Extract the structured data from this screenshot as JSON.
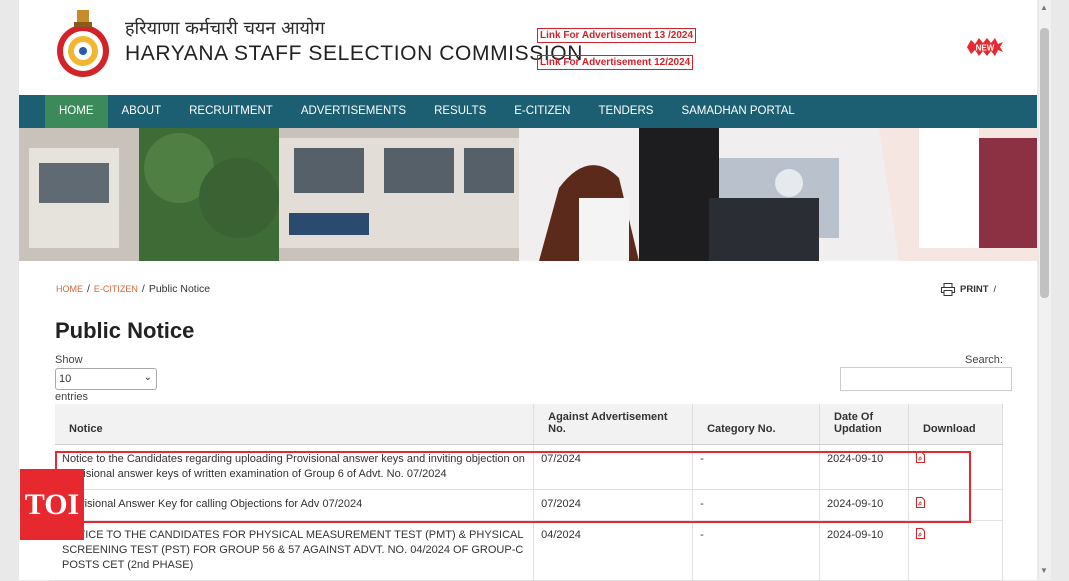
{
  "header": {
    "title_hindi": "हरियाणा कर्मचारी चयन आयोग",
    "title_english": "HARYANA STAFF SELECTION COMMISSION",
    "adv_links": [
      "Link For Advertisement 13 /2024",
      "Link For Advertisement 12/2024"
    ],
    "new_badge": "NEW"
  },
  "nav": {
    "items": [
      "HOME",
      "ABOUT",
      "RECRUITMENT",
      "ADVERTISEMENTS",
      "RESULTS",
      "E-CITIZEN",
      "TENDERS",
      "SAMADHAN PORTAL"
    ],
    "active": "HOME"
  },
  "breadcrumb": {
    "items": [
      "HOME",
      "E-CITIZEN"
    ],
    "current": "Public Notice",
    "separator": "/"
  },
  "print_label": "PRINT",
  "print_sep": "/",
  "page_title": "Public Notice",
  "controls": {
    "show_label": "Show",
    "entries_value": "10",
    "entries_label": "entries",
    "search_label": "Search:"
  },
  "table": {
    "headers": {
      "notice": "Notice",
      "adv": "Against Advertisement No.",
      "cat": "Category No.",
      "date": "Date Of Updation",
      "download": "Download"
    },
    "rows": [
      {
        "notice": "Notice to the Candidates regarding uploading Provisional answer keys and inviting objection on provisional answer keys of written examination of Group 6 of Advt. No. 07/2024",
        "adv": "07/2024",
        "cat": "-",
        "date": "2024-09-10"
      },
      {
        "notice": "Provisional Answer Key for calling Objections for Adv 07/2024",
        "adv": "07/2024",
        "cat": "-",
        "date": "2024-09-10"
      },
      {
        "notice": "NOTICE TO THE CANDIDATES FOR PHYSICAL MEASUREMENT TEST (PMT) & PHYSICAL SCREENING TEST (PST) FOR GROUP 56 & 57 AGAINST ADVT. NO. 04/2024 OF GROUP-C POSTS CET (2nd PHASE)",
        "adv": "04/2024",
        "cat": "-",
        "date": "2024-09-10"
      }
    ]
  },
  "watermark": "TOI",
  "colors": {
    "nav_bg": "#1d5f72",
    "nav_active": "#3c8a5a",
    "link_red": "#d2232a",
    "highlight_red": "#e8282f"
  }
}
